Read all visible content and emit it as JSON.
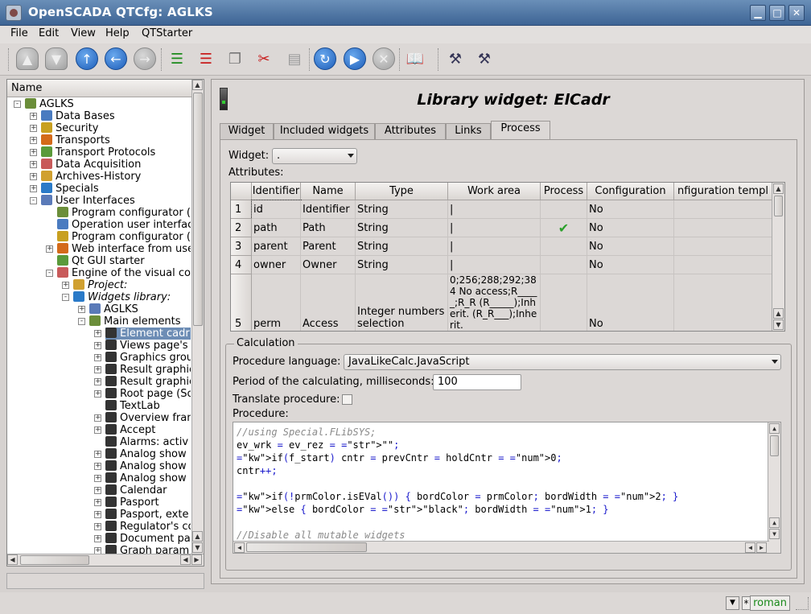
{
  "window": {
    "title": "OpenSCADA QTCfg: AGLKS"
  },
  "menu": [
    "File",
    "Edit",
    "View",
    "Help",
    "QTStarter"
  ],
  "toolbar": {
    "icons": [
      "db-load-icon",
      "db-save-icon",
      "up-icon",
      "back-icon",
      "forward-icon",
      "add-item-icon",
      "delete-item-icon",
      "copy-icon",
      "cut-icon",
      "paste-icon",
      "refresh-icon",
      "start-icon",
      "stop-icon",
      "manual-icon",
      "vcs-engine-icon",
      "uifrm-icon"
    ]
  },
  "tree": {
    "header": "Name",
    "items": [
      {
        "label": "AGLKS",
        "level": 0,
        "expander": "-"
      },
      {
        "label": "Data Bases",
        "level": 1,
        "expander": "+"
      },
      {
        "label": "Security",
        "level": 1,
        "expander": "+"
      },
      {
        "label": "Transports",
        "level": 1,
        "expander": "+"
      },
      {
        "label": "Transport Protocols",
        "level": 1,
        "expander": "+"
      },
      {
        "label": "Data Acquisition",
        "level": 1,
        "expander": "+"
      },
      {
        "label": "Archives-History",
        "level": 1,
        "expander": "+"
      },
      {
        "label": "Specials",
        "level": 1,
        "expander": "+"
      },
      {
        "label": "User Interfaces",
        "level": 1,
        "expander": "-"
      },
      {
        "label": "Program configurator (",
        "level": 2,
        "expander": ""
      },
      {
        "label": "Operation user interfac",
        "level": 2,
        "expander": ""
      },
      {
        "label": "Program configurator (",
        "level": 2,
        "expander": ""
      },
      {
        "label": "Web interface from use",
        "level": 2,
        "expander": "+"
      },
      {
        "label": "Qt GUI starter",
        "level": 2,
        "expander": ""
      },
      {
        "label": "Engine of the visual co",
        "level": 2,
        "expander": "-"
      },
      {
        "label": "Project:",
        "level": 3,
        "expander": "+",
        "italic": true
      },
      {
        "label": "Widgets library:",
        "level": 3,
        "expander": "-",
        "italic": true
      },
      {
        "label": "AGLKS",
        "level": 4,
        "expander": "+"
      },
      {
        "label": "Main elements",
        "level": 4,
        "expander": "-"
      },
      {
        "label": "Element cadr",
        "level": 5,
        "expander": "+",
        "selected": true
      },
      {
        "label": "Views page's",
        "level": 5,
        "expander": "+"
      },
      {
        "label": "Graphics grou",
        "level": 5,
        "expander": "+"
      },
      {
        "label": "Result graphic",
        "level": 5,
        "expander": "+"
      },
      {
        "label": "Result graphic",
        "level": 5,
        "expander": "+"
      },
      {
        "label": "Root page (So",
        "level": 5,
        "expander": "+"
      },
      {
        "label": "TextLab",
        "level": 5,
        "expander": ""
      },
      {
        "label": "Overview fran",
        "level": 5,
        "expander": "+"
      },
      {
        "label": "Accept",
        "level": 5,
        "expander": "+"
      },
      {
        "label": "Alarms: activ",
        "level": 5,
        "expander": ""
      },
      {
        "label": "Analog show",
        "level": 5,
        "expander": "+"
      },
      {
        "label": "Analog show",
        "level": 5,
        "expander": "+"
      },
      {
        "label": "Analog show",
        "level": 5,
        "expander": "+"
      },
      {
        "label": "Calendar",
        "level": 5,
        "expander": "+"
      },
      {
        "label": "Pasport",
        "level": 5,
        "expander": "+"
      },
      {
        "label": "Pasport, exte",
        "level": 5,
        "expander": "+"
      },
      {
        "label": "Regulator's co",
        "level": 5,
        "expander": "+"
      },
      {
        "label": "Document pan",
        "level": 5,
        "expander": "+"
      },
      {
        "label": "Graph param",
        "level": 5,
        "expander": "+"
      }
    ]
  },
  "panel": {
    "title": "Library widget: ElCadr",
    "tabs": [
      "Widget",
      "Included widgets",
      "Attributes",
      "Links",
      "Process"
    ],
    "active_tab": "Process",
    "widget_label": "Widget:",
    "widget_value": ".",
    "attributes_label": "Attributes:",
    "table": {
      "columns": [
        "Identifier",
        "Name",
        "Type",
        "Work area",
        "Process",
        "Configuration",
        "nfiguration templ"
      ],
      "rows": [
        {
          "n": "1",
          "id": "id",
          "name": "Identifier",
          "type": "String",
          "work": "|",
          "process": "",
          "config": "No"
        },
        {
          "n": "2",
          "id": "path",
          "name": "Path",
          "type": "String",
          "work": "|",
          "process": "✔",
          "config": "No"
        },
        {
          "n": "3",
          "id": "parent",
          "name": "Parent",
          "type": "String",
          "work": "|",
          "process": "",
          "config": "No"
        },
        {
          "n": "4",
          "id": "owner",
          "name": "Owner",
          "type": "String",
          "work": "|",
          "process": "",
          "config": "No"
        },
        {
          "n": "5",
          "id": "perm",
          "name": "Access",
          "type": "Integer numbers selection",
          "work": "0;256;288;292;384 No access;R_____;R_R (R_____);Inherit. (R_R___);Inherit.",
          "process": "",
          "config": "No"
        }
      ]
    },
    "calc": {
      "group_title": "Calculation",
      "lang_label": "Procedure language:",
      "lang_value": "JavaLikeCalc.JavaScript",
      "period_label": "Period of the calculating, milliseconds:",
      "period_value": "100",
      "translate_label": "Translate procedure:",
      "procedure_label": "Procedure:",
      "code_lines": [
        "//using Special.FLibSYS;",
        "ev_wrk = ev_rez = \"\";",
        "if(f_start) cntr = prevCntr = holdCntr = 0;",
        "cntr++;",
        "",
        "if(!prmColor.isEVal()) { bordColor = prmColor; bordWidth = 2; }",
        "else { bordColor = \"black\"; bordWidth = 1; }",
        "",
        "//Disable all mutable widgets",
        "info_ed_en = info_var_en = info_sp_en = info_out_en = spToVar_en = up_en = upm_en"
      ]
    }
  },
  "status": {
    "user": "roman",
    "star": "*"
  },
  "colors": {
    "title_bg": "#4a72a4",
    "selection": "#6d8db5",
    "user_text": "#1a8a1a"
  }
}
